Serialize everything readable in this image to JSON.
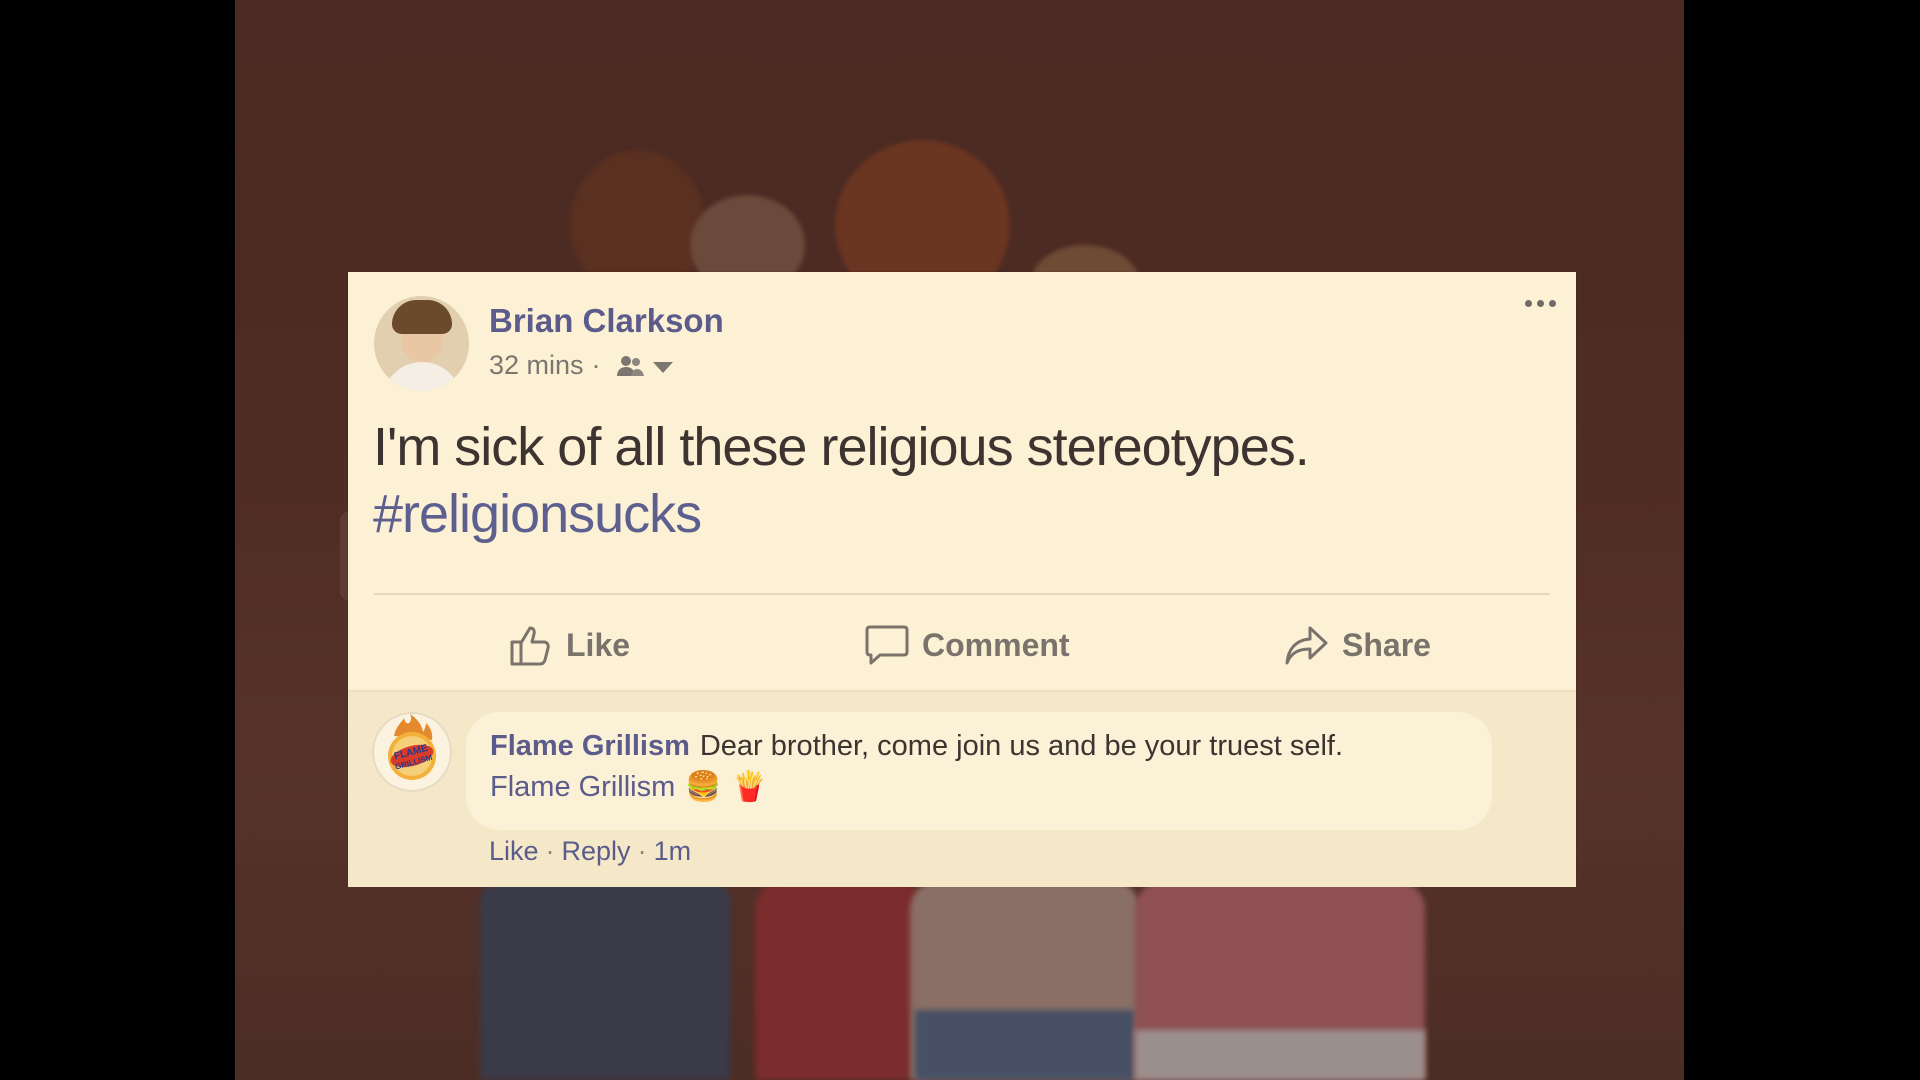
{
  "post": {
    "author": "Brian Clarkson",
    "timestamp": "32 mins",
    "separator": "·",
    "audience_icon": "friends-icon",
    "text": "I'm sick of all these religious stereotypes.",
    "hashtag": "#religionsucks"
  },
  "actions": {
    "like": "Like",
    "comment": "Comment",
    "share": "Share"
  },
  "comment": {
    "author": "Flame Grillism",
    "text": "Dear brother, come join us and be your truest self.",
    "signature": "Flame Grillism",
    "emojis": [
      "🍔",
      "🍟"
    ],
    "like": "Like",
    "reply": "Reply",
    "time": "1m",
    "separator": "·",
    "logo_text": "FLAME GRILLISM"
  },
  "colors": {
    "card_bg": "#fcf1d5",
    "link": "#5b5b8c",
    "text": "#3d3431"
  }
}
